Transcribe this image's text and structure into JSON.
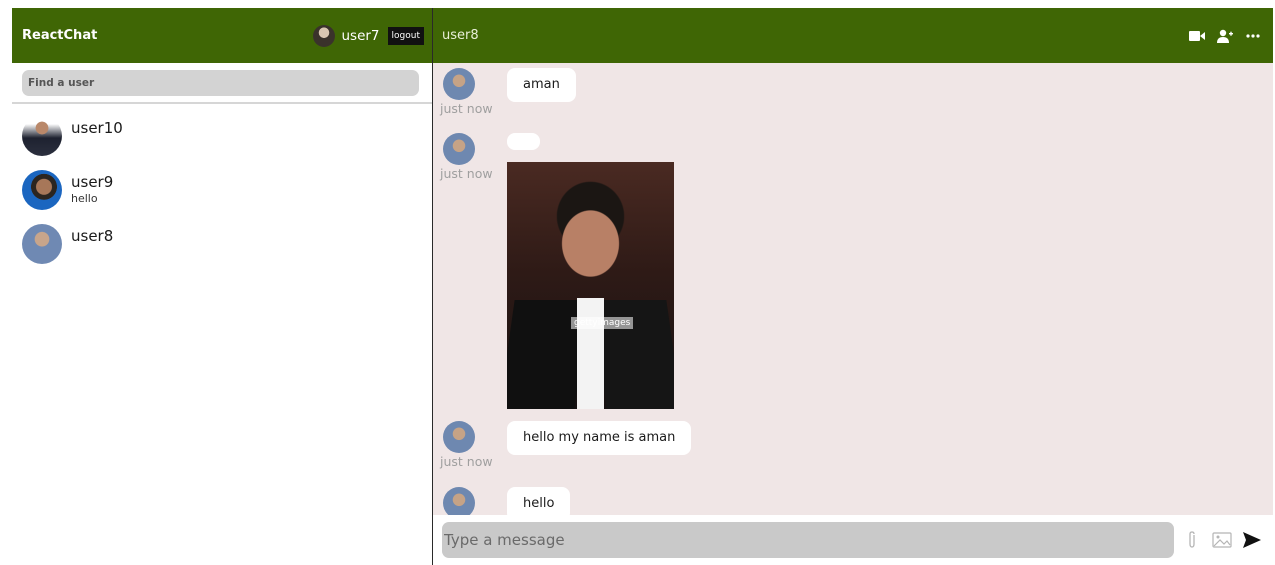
{
  "sidebar": {
    "brand": "ReactChat",
    "current_user": "user7",
    "logout_label": "logout",
    "search_placeholder": "Find a user",
    "users": [
      {
        "name": "user10",
        "last": ""
      },
      {
        "name": "user9",
        "last": "hello"
      },
      {
        "name": "user8",
        "last": ""
      }
    ]
  },
  "chat": {
    "title": "user8",
    "icons": [
      "video-camera-icon",
      "add-user-icon",
      "more-options-icon"
    ],
    "messages": [
      {
        "text": "aman",
        "time": "just now"
      },
      {
        "text": "",
        "time": "just now",
        "image_watermark": "gettyimages"
      },
      {
        "text": "hello my name is aman",
        "time": "just now"
      },
      {
        "text": "hello",
        "time": ""
      }
    ],
    "input_placeholder": "Type a message",
    "input_icons": [
      "attach-icon",
      "image-icon",
      "send-icon"
    ]
  },
  "colors": {
    "header_green": "#3f6605",
    "chat_background": "#f0e6e6",
    "input_gray": "#c9c9c9"
  }
}
